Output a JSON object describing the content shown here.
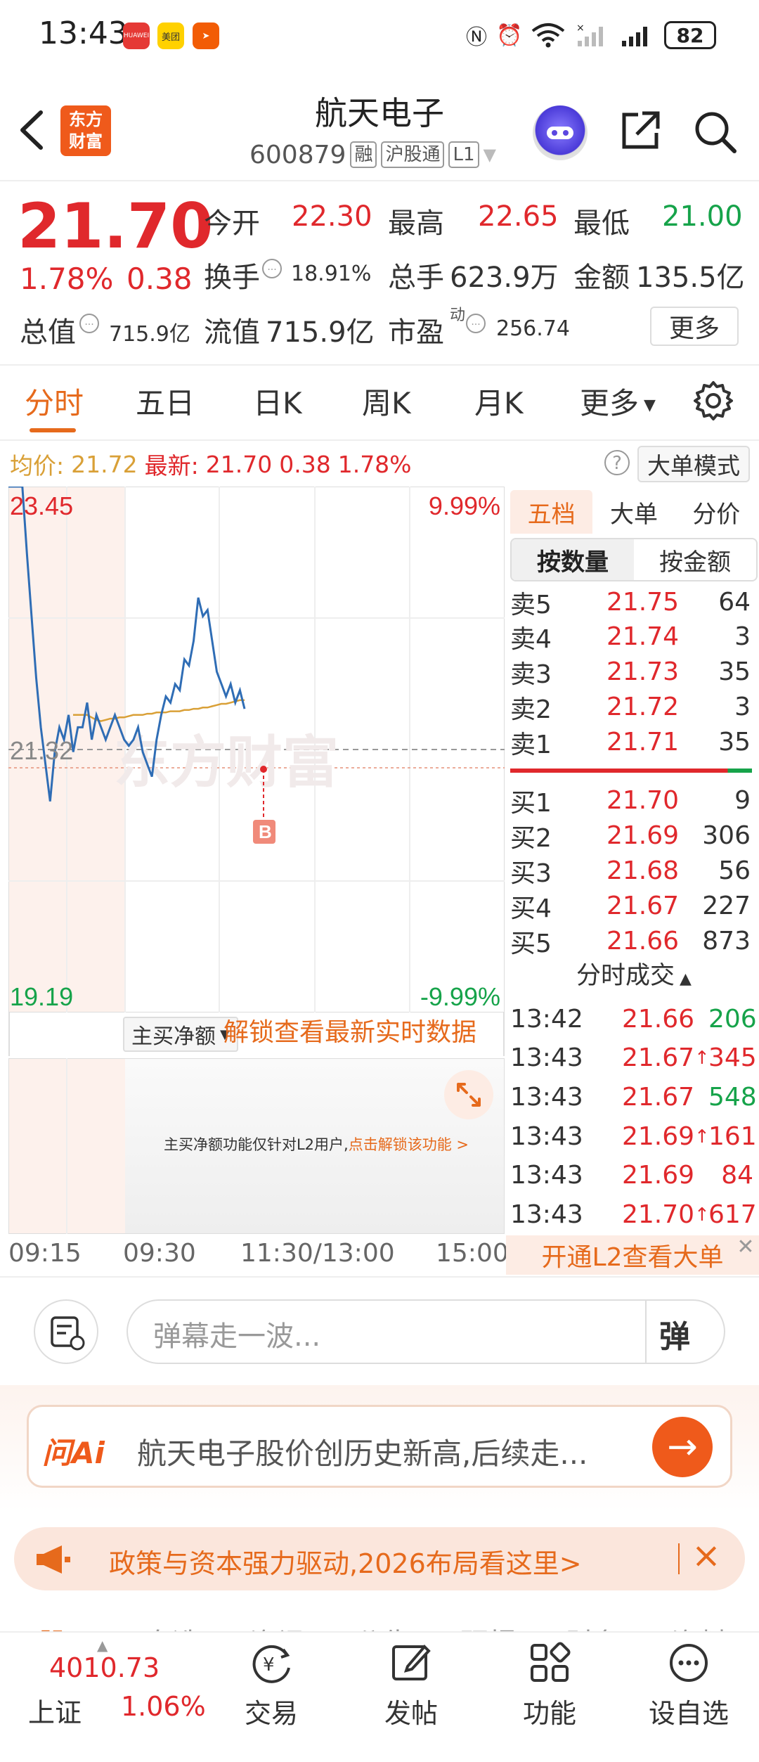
{
  "status_bar": {
    "time": "13:43",
    "app1": "HUAWEI",
    "app2": "美团",
    "battery": "82"
  },
  "header": {
    "logo_line1": "东方",
    "logo_line2": "财富",
    "stock_name": "航天电子",
    "stock_code": "600879",
    "tag_margin": "融",
    "tag_connect": "沪股通",
    "tag_level": "L1"
  },
  "quote": {
    "price": "21.70",
    "change_pct": "1.78%",
    "change": "0.38",
    "open_label": "今开",
    "open": "22.30",
    "high_label": "最高",
    "high": "22.65",
    "low_label": "最低",
    "low": "21.00",
    "turnover_label": "换手",
    "turnover": "18.91%",
    "volume_label": "总手",
    "volume": "623.9万",
    "amount_label": "金额",
    "amount": "135.5亿",
    "mktcap_label": "总值",
    "mktcap": "715.9亿",
    "float_label": "流值",
    "float": "715.9亿",
    "pe_label": "市盈",
    "pe_sup": "动",
    "pe": "256.74",
    "more": "更多"
  },
  "tabs": [
    "分时",
    "五日",
    "日K",
    "周K",
    "月K",
    "更多"
  ],
  "avg_row": {
    "avg_label": "均价:",
    "avg": "21.72",
    "latest_label": "最新:",
    "latest": "21.70",
    "chg": "0.38",
    "pct": "1.78%",
    "big_mode": "大单模式"
  },
  "chart": {
    "y_max": "23.45",
    "y_mid": "21.32",
    "y_min": "19.19",
    "pct_max": "9.99%",
    "pct_min": "-9.99%",
    "marker": "B",
    "watermark": "东方财富",
    "times": [
      "09:15",
      "09:30",
      "11:30/13:00",
      "15:00"
    ],
    "colors": {
      "price": "#2f6db5",
      "avg": "#d9a037"
    }
  },
  "chart_data": {
    "type": "line",
    "ylim": [
      19.19,
      23.45
    ],
    "series": [
      {
        "values": [
          23.45,
          23.45,
          23.45,
          23.45,
          22.9,
          22.4,
          21.9,
          21.5,
          21.2,
          20.9,
          21.3,
          21.5,
          21.4,
          21.6,
          21.3,
          21.5,
          21.5,
          21.7,
          21.4,
          21.6,
          21.5,
          21.4,
          21.5,
          21.6,
          21.5,
          21.4,
          21.35,
          21.4,
          21.5,
          21.3,
          21.2,
          21.1,
          21.4,
          21.6,
          21.75,
          21.7,
          21.85,
          21.8,
          22.05,
          22.0,
          22.2,
          22.55,
          22.4,
          22.45,
          22.2,
          21.95,
          21.85,
          21.75,
          21.85,
          21.7,
          21.8,
          21.65
        ]
      },
      {
        "values": [
          21.6,
          21.6,
          21.6,
          21.6,
          21.58,
          21.56,
          21.55,
          21.56,
          21.57,
          21.57,
          21.58,
          21.58,
          21.59,
          21.6,
          21.6,
          21.6,
          21.61,
          21.61,
          21.62,
          21.62,
          21.62,
          21.63,
          21.63,
          21.63,
          21.64,
          21.64,
          21.65,
          21.65,
          21.66,
          21.66,
          21.67,
          21.68,
          21.69,
          21.69,
          21.7,
          21.71,
          21.72,
          21.72
        ]
      }
    ]
  },
  "orderbook": {
    "tabs": [
      "五档",
      "大单",
      "分价"
    ],
    "sub_tabs": [
      "按数量",
      "按金额"
    ],
    "asks": [
      {
        "label": "卖5",
        "price": "21.75",
        "vol": "64"
      },
      {
        "label": "卖4",
        "price": "21.74",
        "vol": "3"
      },
      {
        "label": "卖3",
        "price": "21.73",
        "vol": "35"
      },
      {
        "label": "卖2",
        "price": "21.72",
        "vol": "3"
      },
      {
        "label": "卖1",
        "price": "21.71",
        "vol": "35"
      }
    ],
    "bids": [
      {
        "label": "买1",
        "price": "21.70",
        "vol": "9"
      },
      {
        "label": "买2",
        "price": "21.69",
        "vol": "306"
      },
      {
        "label": "买3",
        "price": "21.68",
        "vol": "56"
      },
      {
        "label": "买4",
        "price": "21.67",
        "vol": "227"
      },
      {
        "label": "买5",
        "price": "21.66",
        "vol": "873"
      }
    ],
    "trades_title": "分时成交",
    "trades": [
      {
        "time": "13:42",
        "price": "21.66",
        "arrow": "",
        "vol": "206",
        "color": "green"
      },
      {
        "time": "13:43",
        "price": "21.67",
        "arrow": "↑",
        "vol": "345",
        "color": "red"
      },
      {
        "time": "13:43",
        "price": "21.67",
        "arrow": "",
        "vol": "548",
        "color": "green"
      },
      {
        "time": "13:43",
        "price": "21.69",
        "arrow": "↑",
        "vol": "161",
        "color": "red"
      },
      {
        "time": "13:43",
        "price": "21.69",
        "arrow": "",
        "vol": "84",
        "color": "red"
      },
      {
        "time": "13:43",
        "price": "21.70",
        "arrow": "↑",
        "vol": "617",
        "color": "red"
      }
    ],
    "l2_cta": "开通L2查看大单"
  },
  "lower_chart": {
    "select": "主买净额",
    "unlock": "解锁查看最新实时数据",
    "note": "主买净额功能仅针对L2用户,",
    "note_link": "点击解锁该功能 >"
  },
  "danmu": {
    "placeholder": "弹幕走一波...",
    "button": "弹"
  },
  "ai": {
    "logo": "问Ai",
    "prompt": "航天电子股价创历史新高,后续走..."
  },
  "banner": {
    "text": "政策与资本强力驱动,2026布局看这里>"
  },
  "peek_tabs": [
    "股吧",
    "自选",
    "资讯",
    "公告",
    "研报",
    "财务",
    "资料"
  ],
  "bottom_nav": {
    "index_value": "4010.73",
    "index_name": "上证",
    "index_pct": "1.06%",
    "items": [
      "交易",
      "发帖",
      "功能",
      "设自选"
    ]
  }
}
